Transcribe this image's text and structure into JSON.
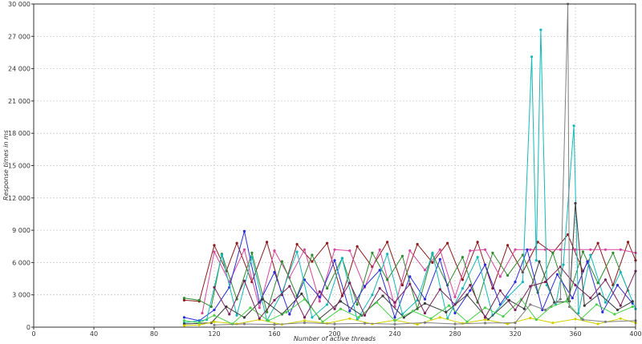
{
  "chart_data": {
    "type": "line",
    "title": "",
    "xlabel": "Number of active threads",
    "ylabel": "Response times in ms",
    "xlim": [
      0,
      400
    ],
    "ylim": [
      0,
      30000
    ],
    "x_ticks": [
      0,
      40,
      80,
      120,
      160,
      200,
      240,
      280,
      320,
      360,
      400
    ],
    "y_ticks": [
      0,
      3000,
      6000,
      9000,
      12000,
      15000,
      18000,
      21000,
      24000,
      27000,
      30000
    ],
    "x_tick_labels": [
      "0",
      "40",
      "80",
      "120",
      "160",
      "200",
      "240",
      "280",
      "320",
      "360",
      "400"
    ],
    "y_tick_labels": [
      "0",
      "3 000",
      "6 000",
      "9 000",
      "12 000",
      "15 000",
      "18 000",
      "21 000",
      "24 000",
      "27 000",
      "30 000"
    ],
    "grid": true,
    "legend": "none",
    "series": [
      {
        "color": "#8b1a1a",
        "values": [
          [
            100,
            2500
          ],
          [
            110,
            2400
          ],
          [
            120,
            7600
          ],
          [
            128,
            5200
          ],
          [
            135,
            7800
          ],
          [
            145,
            4200
          ],
          [
            155,
            7900
          ],
          [
            165,
            3000
          ],
          [
            175,
            7700
          ],
          [
            185,
            6100
          ],
          [
            195,
            7800
          ],
          [
            205,
            2900
          ],
          [
            215,
            7500
          ],
          [
            225,
            5600
          ],
          [
            235,
            7900
          ],
          [
            245,
            3900
          ],
          [
            255,
            7700
          ],
          [
            265,
            6000
          ],
          [
            275,
            7800
          ],
          [
            285,
            4400
          ],
          [
            295,
            7900
          ],
          [
            305,
            3600
          ],
          [
            315,
            7600
          ],
          [
            325,
            5100
          ],
          [
            335,
            7900
          ],
          [
            345,
            6900
          ],
          [
            355,
            8600
          ],
          [
            365,
            5200
          ],
          [
            375,
            7800
          ],
          [
            385,
            3900
          ],
          [
            395,
            7900
          ],
          [
            400,
            6200
          ]
        ]
      },
      {
        "color": "#d7479d",
        "values": [
          [
            112,
            1300
          ],
          [
            120,
            7000
          ],
          [
            130,
            4200
          ],
          [
            140,
            7200
          ],
          [
            150,
            1800
          ],
          [
            160,
            7100
          ],
          [
            170,
            4600
          ],
          [
            180,
            7200
          ],
          [
            190,
            2400
          ],
          [
            200,
            7200
          ],
          [
            210,
            7100
          ],
          [
            220,
            3700
          ],
          [
            230,
            7200
          ],
          [
            240,
            1900
          ],
          [
            250,
            7100
          ],
          [
            260,
            5300
          ],
          [
            270,
            7200
          ],
          [
            280,
            2800
          ],
          [
            290,
            7100
          ],
          [
            300,
            7200
          ],
          [
            310,
            4700
          ],
          [
            320,
            7200
          ],
          [
            330,
            7200
          ],
          [
            340,
            7200
          ],
          [
            350,
            7200
          ],
          [
            360,
            7200
          ],
          [
            370,
            7200
          ],
          [
            380,
            7200
          ],
          [
            390,
            7200
          ],
          [
            400,
            6900
          ]
        ]
      },
      {
        "color": "#2e8b2e",
        "values": [
          [
            100,
            2700
          ],
          [
            110,
            2500
          ],
          [
            118,
            1900
          ],
          [
            125,
            6800
          ],
          [
            135,
            2600
          ],
          [
            145,
            6900
          ],
          [
            155,
            1400
          ],
          [
            165,
            6100
          ],
          [
            175,
            2900
          ],
          [
            185,
            6700
          ],
          [
            195,
            3600
          ],
          [
            205,
            6400
          ],
          [
            215,
            2100
          ],
          [
            225,
            6900
          ],
          [
            235,
            4400
          ],
          [
            245,
            6600
          ],
          [
            255,
            1700
          ],
          [
            265,
            6800
          ],
          [
            275,
            3900
          ],
          [
            285,
            6500
          ],
          [
            295,
            2300
          ],
          [
            305,
            6900
          ],
          [
            315,
            4800
          ],
          [
            325,
            6700
          ],
          [
            335,
            3200
          ],
          [
            345,
            6900
          ],
          [
            355,
            2600
          ],
          [
            365,
            7000
          ],
          [
            375,
            4100
          ],
          [
            385,
            6900
          ],
          [
            395,
            3400
          ]
        ]
      },
      {
        "color": "#2b2bd9",
        "values": [
          [
            100,
            900
          ],
          [
            110,
            600
          ],
          [
            120,
            1600
          ],
          [
            130,
            3700
          ],
          [
            140,
            8900
          ],
          [
            150,
            2300
          ],
          [
            160,
            5100
          ],
          [
            170,
            1200
          ],
          [
            180,
            4400
          ],
          [
            190,
            2800
          ],
          [
            200,
            6200
          ],
          [
            210,
            1500
          ],
          [
            220,
            3800
          ],
          [
            230,
            5300
          ],
          [
            240,
            900
          ],
          [
            250,
            4700
          ],
          [
            260,
            2600
          ],
          [
            270,
            6300
          ],
          [
            280,
            1300
          ],
          [
            290,
            3400
          ],
          [
            300,
            5800
          ],
          [
            310,
            2100
          ],
          [
            320,
            4200
          ],
          [
            328,
            7200
          ],
          [
            338,
            1600
          ],
          [
            348,
            4900
          ],
          [
            358,
            2700
          ],
          [
            368,
            6100
          ],
          [
            378,
            1400
          ],
          [
            388,
            3900
          ],
          [
            398,
            2200
          ]
        ]
      },
      {
        "color": "#14b8b8",
        "values": [
          [
            100,
            400
          ],
          [
            115,
            700
          ],
          [
            125,
            6700
          ],
          [
            135,
            1100
          ],
          [
            145,
            6500
          ],
          [
            155,
            600
          ],
          [
            165,
            3200
          ],
          [
            175,
            7000
          ],
          [
            185,
            900
          ],
          [
            195,
            2100
          ],
          [
            205,
            6400
          ],
          [
            215,
            700
          ],
          [
            225,
            3000
          ],
          [
            235,
            6800
          ],
          [
            245,
            1200
          ],
          [
            255,
            2500
          ],
          [
            265,
            6900
          ],
          [
            275,
            800
          ],
          [
            285,
            3600
          ],
          [
            295,
            6500
          ],
          [
            305,
            1100
          ],
          [
            315,
            2800
          ],
          [
            325,
            4200
          ],
          [
            331,
            25100
          ],
          [
            334,
            6200
          ],
          [
            337,
            27600
          ],
          [
            341,
            3900
          ],
          [
            347,
            2100
          ],
          [
            352,
            5800
          ],
          [
            359,
            18700
          ],
          [
            362,
            1300
          ],
          [
            370,
            6700
          ],
          [
            380,
            2300
          ],
          [
            390,
            5100
          ],
          [
            400,
            1700
          ]
        ]
      },
      {
        "color": "#3a3a3a",
        "values": [
          [
            100,
            300
          ],
          [
            118,
            400
          ],
          [
            128,
            1900
          ],
          [
            140,
            900
          ],
          [
            152,
            2600
          ],
          [
            165,
            1200
          ],
          [
            178,
            3100
          ],
          [
            190,
            800
          ],
          [
            204,
            2400
          ],
          [
            218,
            1100
          ],
          [
            232,
            2900
          ],
          [
            246,
            900
          ],
          [
            260,
            2200
          ],
          [
            274,
            1400
          ],
          [
            288,
            3000
          ],
          [
            302,
            700
          ],
          [
            316,
            2500
          ],
          [
            326,
            1700
          ],
          [
            336,
            6100
          ],
          [
            346,
            2300
          ],
          [
            356,
            2400
          ],
          [
            360,
            11500
          ],
          [
            366,
            2000
          ],
          [
            376,
            3100
          ],
          [
            388,
            1600
          ],
          [
            398,
            2400
          ]
        ]
      },
      {
        "color": "#d4d000",
        "values": [
          [
            100,
            150
          ],
          [
            110,
            200
          ],
          [
            120,
            500
          ],
          [
            135,
            300
          ],
          [
            150,
            700
          ],
          [
            165,
            250
          ],
          [
            180,
            600
          ],
          [
            195,
            350
          ],
          [
            210,
            800
          ],
          [
            225,
            300
          ],
          [
            240,
            650
          ],
          [
            255,
            250
          ],
          [
            270,
            900
          ],
          [
            285,
            350
          ],
          [
            300,
            700
          ],
          [
            315,
            300
          ],
          [
            330,
            850
          ],
          [
            345,
            400
          ],
          [
            360,
            750
          ],
          [
            375,
            300
          ],
          [
            390,
            800
          ],
          [
            400,
            400
          ]
        ]
      },
      {
        "color": "#4ad14a",
        "values": [
          [
            100,
            600
          ],
          [
            110,
            400
          ],
          [
            120,
            1100
          ],
          [
            132,
            300
          ],
          [
            144,
            1800
          ],
          [
            156,
            600
          ],
          [
            168,
            1400
          ],
          [
            180,
            2600
          ],
          [
            192,
            500
          ],
          [
            204,
            1700
          ],
          [
            216,
            900
          ],
          [
            228,
            2300
          ],
          [
            240,
            600
          ],
          [
            252,
            1500
          ],
          [
            264,
            800
          ],
          [
            276,
            2000
          ],
          [
            288,
            500
          ],
          [
            300,
            1800
          ],
          [
            312,
            1000
          ],
          [
            324,
            2600
          ],
          [
            334,
            700
          ],
          [
            344,
            1900
          ],
          [
            354,
            2400
          ],
          [
            364,
            800
          ],
          [
            374,
            2100
          ],
          [
            386,
            1200
          ],
          [
            398,
            1900
          ]
        ]
      },
      {
        "color": "#7a1f5c",
        "values": [
          [
            120,
            3700
          ],
          [
            130,
            1200
          ],
          [
            140,
            4300
          ],
          [
            150,
            800
          ],
          [
            160,
            2500
          ],
          [
            170,
            3800
          ],
          [
            180,
            900
          ],
          [
            190,
            3300
          ],
          [
            200,
            1700
          ],
          [
            210,
            4100
          ],
          [
            220,
            1100
          ],
          [
            230,
            3600
          ],
          [
            240,
            2300
          ],
          [
            250,
            4000
          ],
          [
            260,
            1300
          ],
          [
            270,
            3500
          ],
          [
            280,
            2100
          ],
          [
            290,
            3900
          ],
          [
            300,
            900
          ],
          [
            310,
            3400
          ],
          [
            320,
            1600
          ],
          [
            330,
            3800
          ],
          [
            340,
            4200
          ],
          [
            350,
            5600
          ],
          [
            360,
            3900
          ],
          [
            370,
            2700
          ],
          [
            380,
            4400
          ],
          [
            390,
            2000
          ],
          [
            400,
            5200
          ]
        ]
      },
      {
        "color": "#808080",
        "values": [
          [
            120,
            200
          ],
          [
            140,
            300
          ],
          [
            160,
            250
          ],
          [
            180,
            400
          ],
          [
            200,
            300
          ],
          [
            220,
            350
          ],
          [
            240,
            280
          ],
          [
            260,
            420
          ],
          [
            280,
            300
          ],
          [
            300,
            380
          ],
          [
            320,
            400
          ],
          [
            330,
            2100
          ],
          [
            340,
            1600
          ],
          [
            350,
            2600
          ],
          [
            355,
            30000
          ],
          [
            356,
            1900
          ],
          [
            365,
            700
          ],
          [
            380,
            500
          ],
          [
            400,
            600
          ]
        ]
      }
    ]
  }
}
